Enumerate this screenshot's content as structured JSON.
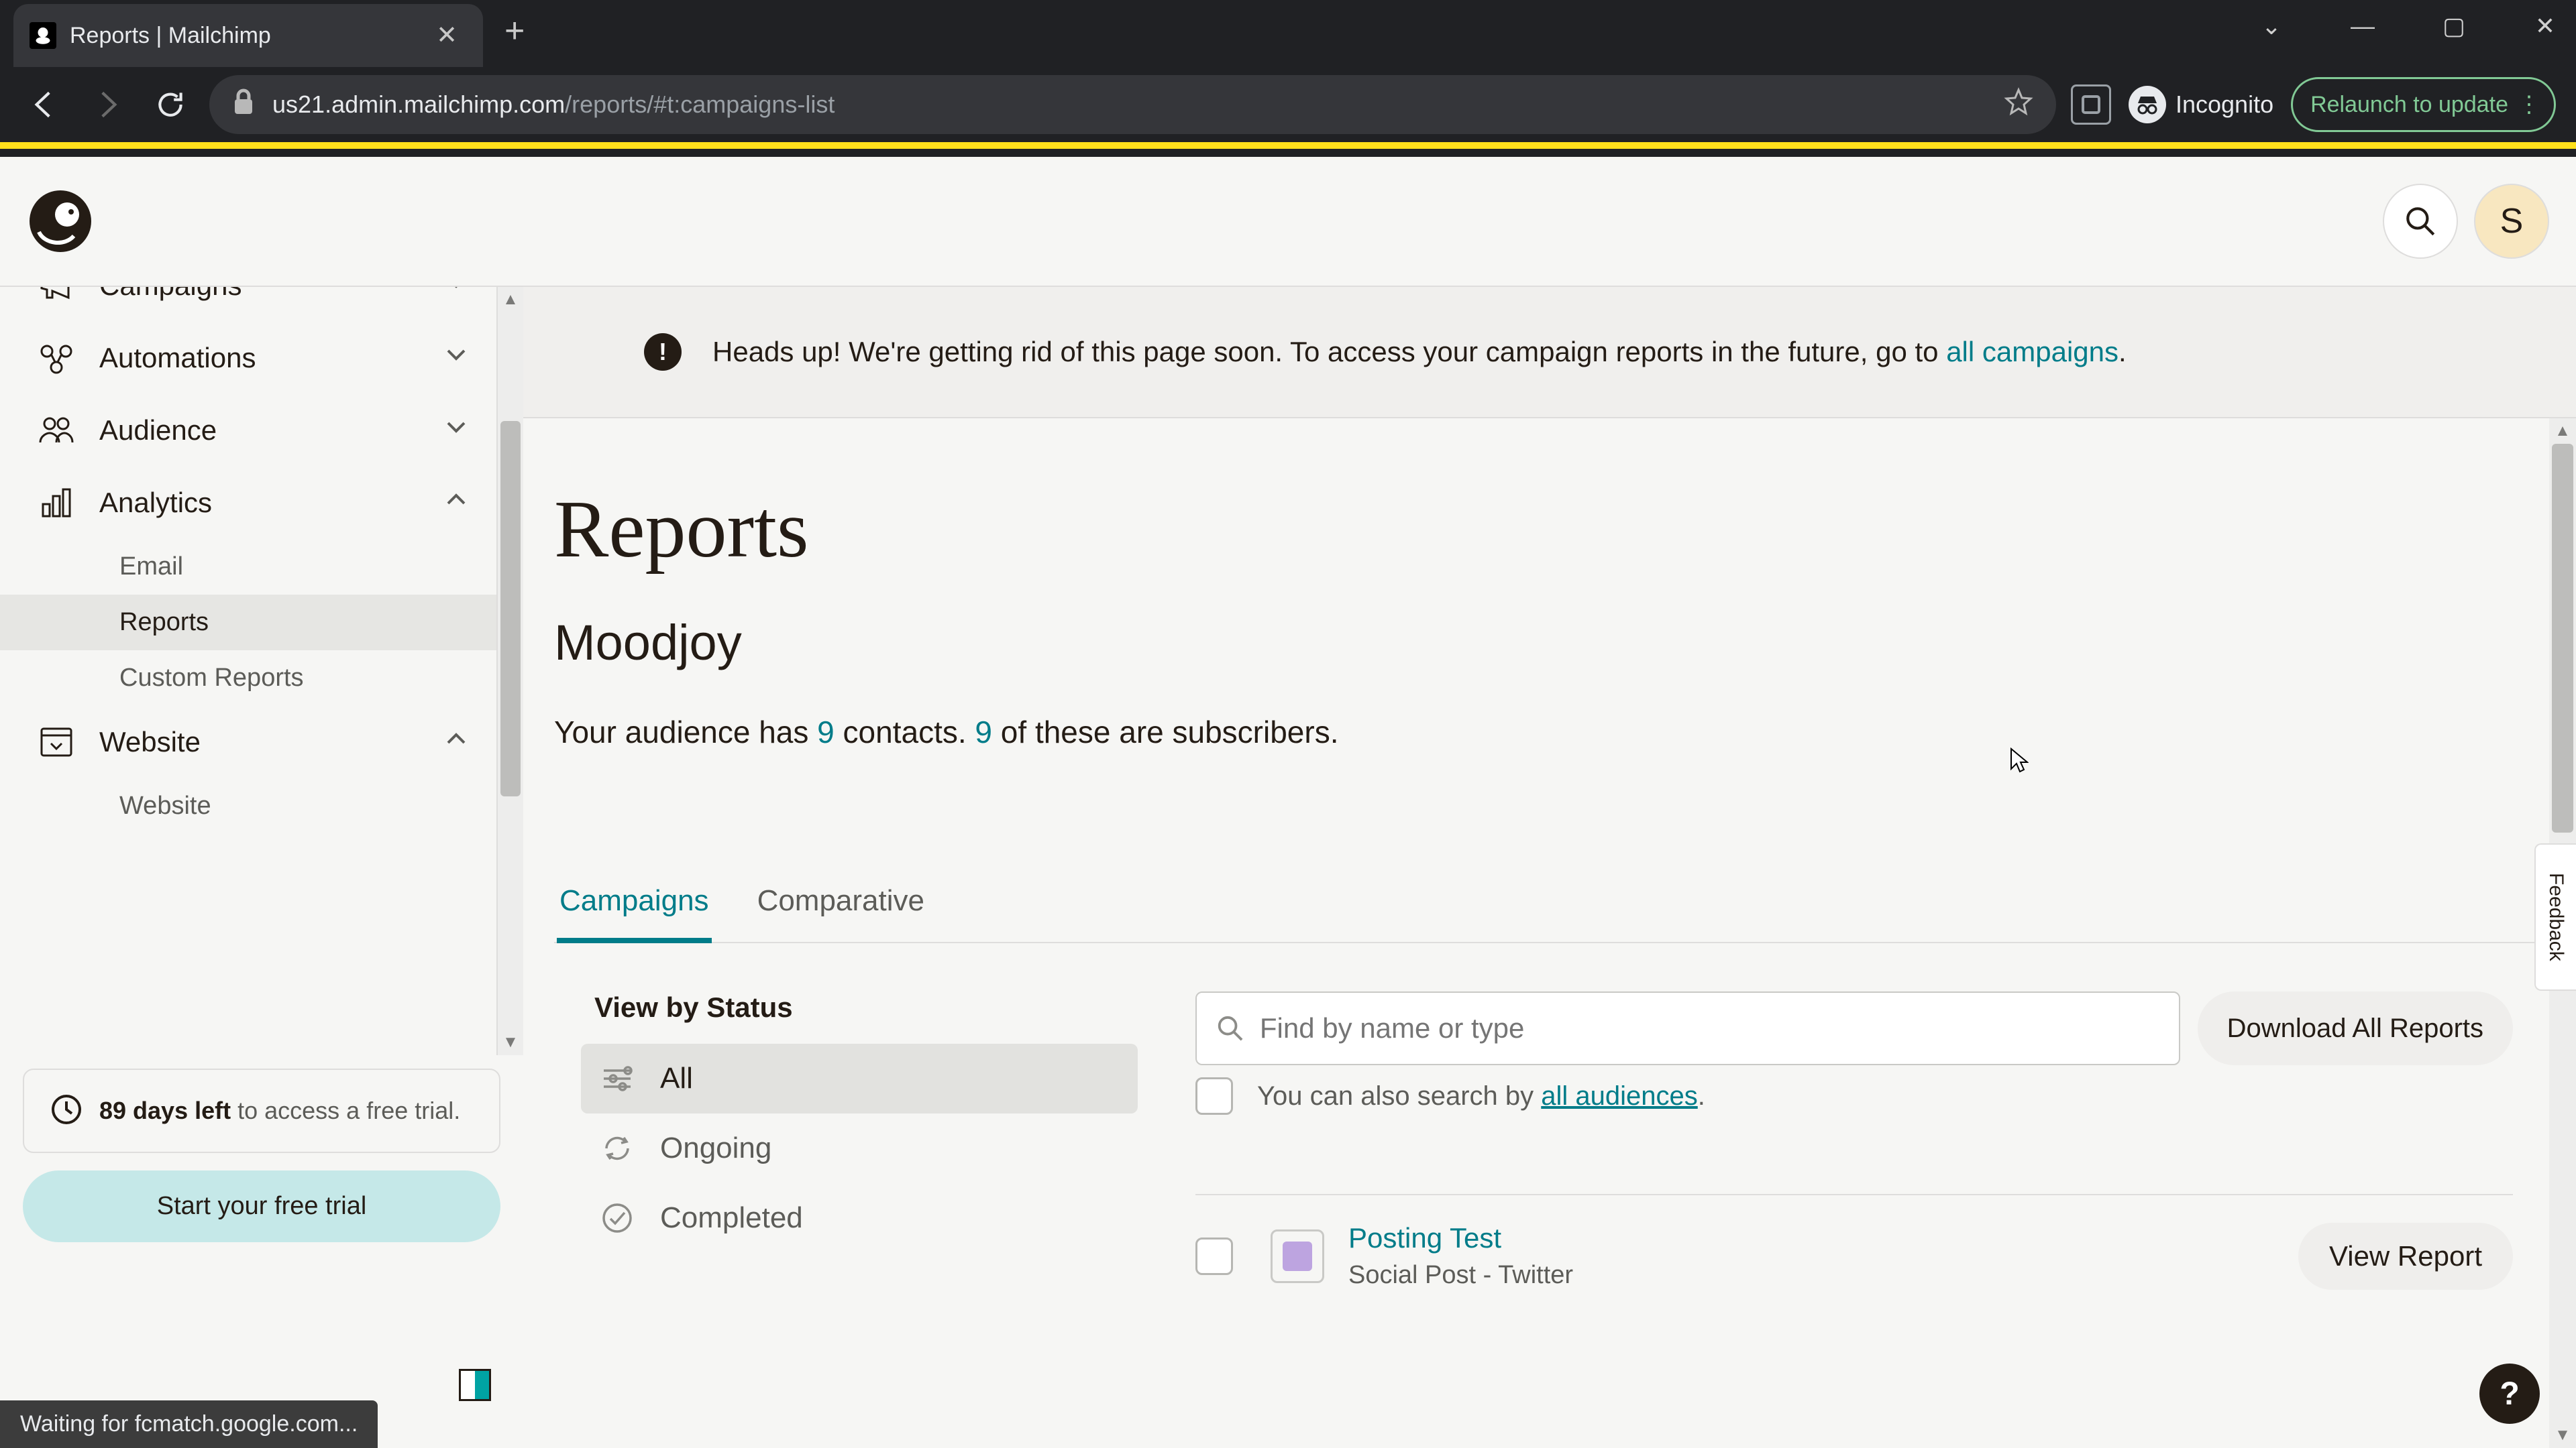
{
  "browser": {
    "tab_title": "Reports | Mailchimp",
    "url_host": "us21.admin.mailchimp.com",
    "url_path": "/reports/#t:campaigns-list",
    "incognito_label": "Incognito",
    "relaunch_label": "Relaunch to update"
  },
  "app": {
    "avatar_letter": "S",
    "feedback_label": "Feedback",
    "help_symbol": "?"
  },
  "sidebar": {
    "items": [
      {
        "label": "Campaigns",
        "expanded": false
      },
      {
        "label": "Automations",
        "expanded": false
      },
      {
        "label": "Audience",
        "expanded": false
      },
      {
        "label": "Analytics",
        "expanded": true,
        "children": [
          {
            "label": "Email"
          },
          {
            "label": "Reports",
            "active": true
          },
          {
            "label": "Custom Reports"
          }
        ]
      },
      {
        "label": "Website",
        "expanded": true,
        "children": [
          {
            "label": "Website"
          }
        ]
      }
    ],
    "trial": {
      "bold": "89 days left",
      "rest": " to access a free trial.",
      "cta": "Start your free trial"
    }
  },
  "banner": {
    "text_pre": "Heads up! We're getting rid of this page soon. To access your campaign reports in the future, go to ",
    "link": "all campaigns",
    "text_post": "."
  },
  "page": {
    "title": "Reports",
    "org": "Moodjoy",
    "aud_pre": "Your audience has ",
    "aud_contacts": "9",
    "aud_mid": " contacts. ",
    "aud_subs": "9",
    "aud_post": " of these are subscribers."
  },
  "tabs": {
    "campaigns": "Campaigns",
    "comparative": "Comparative"
  },
  "filters": {
    "title": "View by Status",
    "statuses": [
      "All",
      "Ongoing",
      "Completed"
    ]
  },
  "search": {
    "placeholder": "Find by name or type",
    "download_label": "Download All Reports",
    "aux_pre": "You can also search by ",
    "aux_link": "all audiences",
    "aux_post": "."
  },
  "list": {
    "items": [
      {
        "title": "Posting Test",
        "subtitle": "Social Post - Twitter",
        "action": "View Report"
      }
    ]
  },
  "statusbar": {
    "text": "Waiting for fcmatch.google.com..."
  }
}
